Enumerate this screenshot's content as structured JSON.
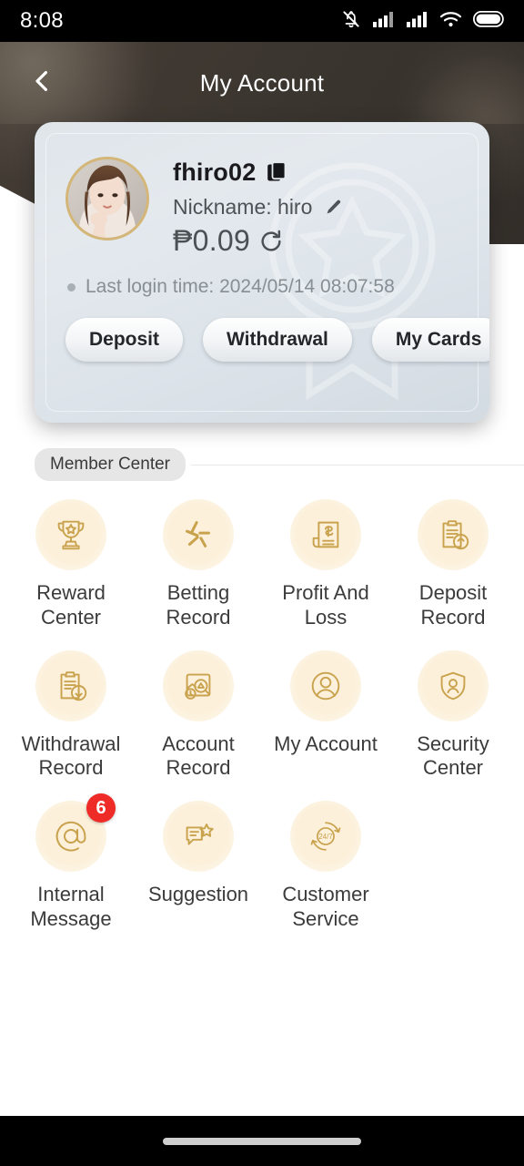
{
  "status_bar": {
    "time": "8:08",
    "icons": [
      "bell-muted-icon",
      "signal-1-icon",
      "signal-2-icon",
      "wifi-icon",
      "battery-icon"
    ]
  },
  "header": {
    "title": "My Account",
    "back_icon": "chevron-left-icon"
  },
  "profile": {
    "username": "fhiro02",
    "copy_icon": "copy-icon",
    "nickname_label": "Nickname: hiro",
    "edit_icon": "pencil-icon",
    "balance": "₱0.09",
    "refresh_icon": "refresh-icon",
    "last_login": "Last login time: 2024/05/14 08:07:58",
    "actions": [
      {
        "label": "Deposit",
        "name": "deposit-button"
      },
      {
        "label": "Withdrawal",
        "name": "withdrawal-button"
      },
      {
        "label": "My Cards",
        "name": "my-cards-button"
      }
    ]
  },
  "member_center": {
    "tag": "Member Center",
    "items": [
      {
        "label": "Reward Center",
        "icon": "trophy-icon",
        "badge": null
      },
      {
        "label": "Betting Record",
        "icon": "betting-sticks-icon",
        "badge": null
      },
      {
        "label": "Profit And Loss",
        "icon": "document-dollar-icon",
        "badge": null
      },
      {
        "label": "Deposit Record",
        "icon": "clipboard-up-icon",
        "badge": null
      },
      {
        "label": "Withdrawal Record",
        "icon": "clipboard-down-icon",
        "badge": null
      },
      {
        "label": "Account Record",
        "icon": "chart-search-icon",
        "badge": null
      },
      {
        "label": "My Account",
        "icon": "user-circle-icon",
        "badge": null
      },
      {
        "label": "Security Center",
        "icon": "shield-user-icon",
        "badge": null
      },
      {
        "label": "Internal Message",
        "icon": "at-sign-icon",
        "badge": "6"
      },
      {
        "label": "Suggestion",
        "icon": "chat-star-icon",
        "badge": null
      },
      {
        "label": "Customer Service",
        "icon": "support-247-icon",
        "badge": null
      }
    ]
  },
  "colors": {
    "accent_gold": "#c9a24d",
    "icon_bg": "#fcf0da",
    "badge_red": "#ee2b27",
    "header_dark": "#3e3832",
    "card_bg": "#e0e6ec"
  },
  "nav_bar": {
    "gesture_pill": "home-indicator"
  }
}
